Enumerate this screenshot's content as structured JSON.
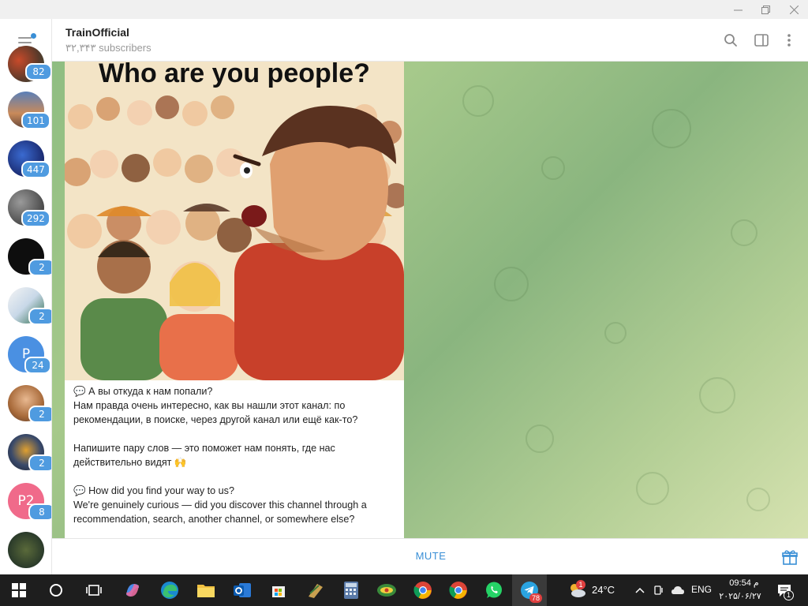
{
  "window": {
    "minimize_icon": "minimize-icon",
    "maximize_icon": "restore-icon",
    "close_icon": "close-icon"
  },
  "sidebar": {
    "menu_icon": "hamburger-menu-icon",
    "chats": [
      {
        "badge": "82",
        "icon": "chat-avatar-1"
      },
      {
        "badge": "101",
        "icon": "chat-avatar-2"
      },
      {
        "badge": "447",
        "icon": "chat-avatar-3"
      },
      {
        "badge": "292",
        "icon": "chat-avatar-4"
      },
      {
        "badge": "2",
        "icon": "chat-avatar-5"
      },
      {
        "badge": "2",
        "icon": "chat-avatar-6"
      },
      {
        "badge": "24",
        "initials": "P"
      },
      {
        "badge": "2",
        "icon": "chat-avatar-8"
      },
      {
        "badge": "2",
        "icon": "chat-avatar-9"
      },
      {
        "badge": "8",
        "initials": "P2"
      },
      {
        "badge": "",
        "icon": "chat-avatar-11"
      }
    ]
  },
  "header": {
    "title": "TrainOfficial",
    "subtitle": "۳۲,۳۴۳ subscribers",
    "icons": [
      "search-icon",
      "sidebar-toggle-icon",
      "more-vertical-icon"
    ]
  },
  "message": {
    "image_caption": "Who are you people?",
    "text": "💬 А вы откуда к нам попали?\nНам правда очень интересно, как вы нашли этот канал: по рекомендации, в поиске, через другой канал или ещё как-то?\n\nНапишите пару слов — это поможет нам понять, где нас действительно видят 🙌\n\n💬 How did you find your way to us?\nWe're genuinely curious — did you discover this channel through a recommendation, search, another channel, or somewhere else?"
  },
  "bottom": {
    "mute_label": "MUTE",
    "gift_icon": "gift-icon"
  },
  "taskbar": {
    "apps": [
      "start-icon",
      "search-icon",
      "task-view-icon",
      "copilot-icon",
      "edge-icon",
      "file-explorer-icon",
      "outlook-icon",
      "store-icon",
      "app-icon",
      "calculator-icon",
      "app-icon-2",
      "chrome-icon",
      "chrome-icon-2",
      "whatsapp-icon",
      "telegram-icon"
    ],
    "telegram_badge": "78",
    "weather_temp": "24°C",
    "weather_badge": "1",
    "language": "ENG",
    "time": "09:54 م",
    "date": "۲۰۲۵/۰۶/۲۷",
    "notifications_badge": "1"
  },
  "colors": {
    "accent": "#3a8fd6",
    "badge": "#4f9be0",
    "chat_bg": "#8fbd82"
  }
}
